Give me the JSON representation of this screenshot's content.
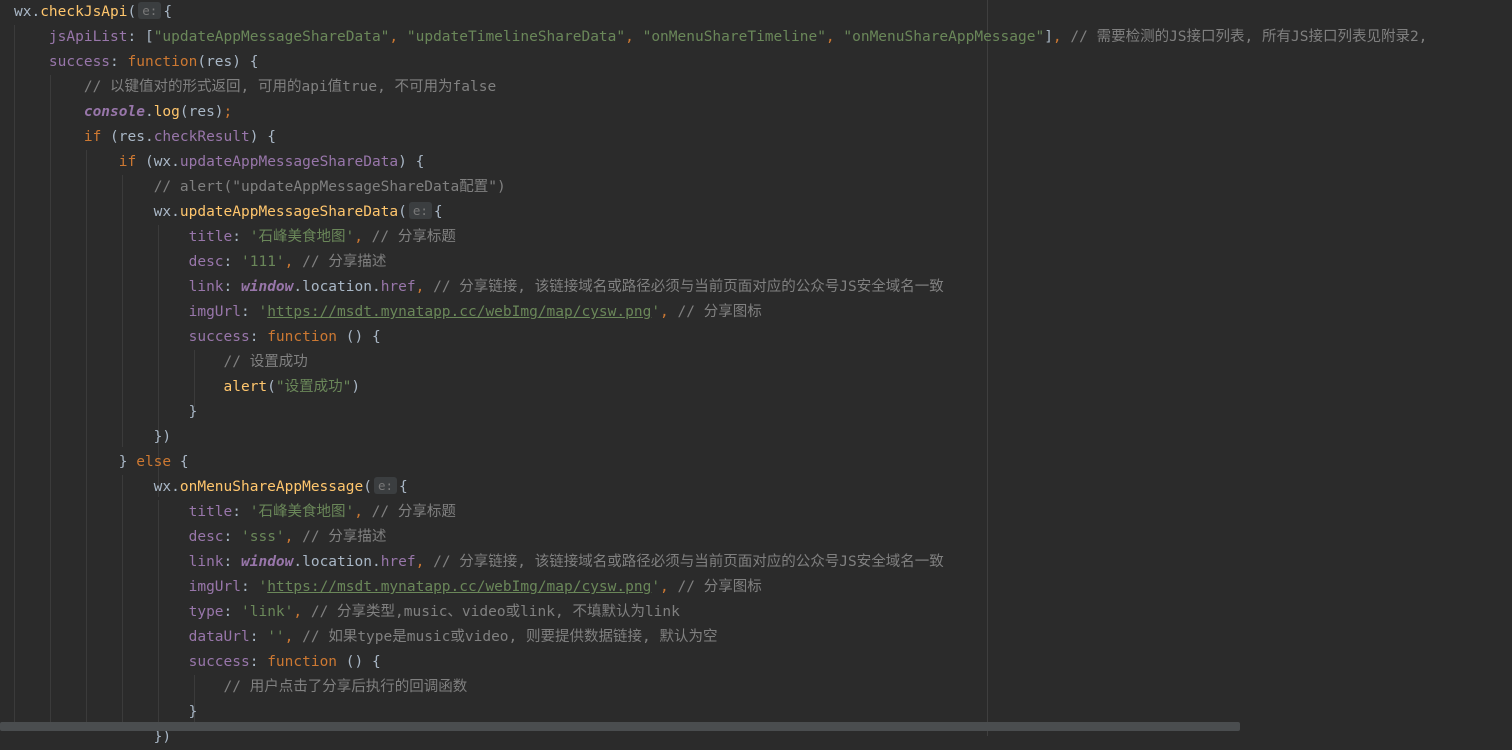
{
  "editor": {
    "param_hint": "e:",
    "lines": [
      [
        [
          "t-plain",
          "wx."
        ],
        [
          "t-fn",
          "checkJsApi"
        ],
        [
          "t-plain",
          "("
        ],
        [
          "hint",
          "e:"
        ],
        [
          "t-plain",
          "{"
        ]
      ],
      [
        [
          "t-plain",
          "    "
        ],
        [
          "t-prop",
          "jsApiList"
        ],
        [
          "t-plain",
          ": ["
        ],
        [
          "t-str",
          "\"updateAppMessageShareData\""
        ],
        [
          "t-kw",
          ", "
        ],
        [
          "t-str",
          "\"updateTimelineShareData\""
        ],
        [
          "t-kw",
          ", "
        ],
        [
          "t-str",
          "\"onMenuShareTimeline\""
        ],
        [
          "t-kw",
          ", "
        ],
        [
          "t-str",
          "\"onMenuShareAppMessage\""
        ],
        [
          "t-plain",
          "]"
        ],
        [
          "t-kw",
          ", "
        ],
        [
          "t-com",
          "// 需要检测的JS接口列表, 所有JS接口列表见附录2,"
        ]
      ],
      [
        [
          "t-plain",
          "    "
        ],
        [
          "t-prop",
          "success"
        ],
        [
          "t-plain",
          ": "
        ],
        [
          "t-kw",
          "function"
        ],
        [
          "t-plain",
          "(res) {"
        ]
      ],
      [
        [
          "t-plain",
          "        "
        ],
        [
          "t-com",
          "// 以键值对的形式返回, 可用的api值true, 不可用为false"
        ]
      ],
      [
        [
          "t-plain",
          "        "
        ],
        [
          "t-ital",
          "console"
        ],
        [
          "t-plain",
          "."
        ],
        [
          "t-fn",
          "log"
        ],
        [
          "t-plain",
          "(res)"
        ],
        [
          "t-kw",
          ";"
        ]
      ],
      [
        [
          "t-plain",
          "        "
        ],
        [
          "t-kw",
          "if "
        ],
        [
          "t-plain",
          "(res."
        ],
        [
          "t-prop",
          "checkResult"
        ],
        [
          "t-plain",
          ") {"
        ]
      ],
      [
        [
          "t-plain",
          "            "
        ],
        [
          "t-kw",
          "if "
        ],
        [
          "t-plain",
          "(wx."
        ],
        [
          "t-prop",
          "updateAppMessageShareData"
        ],
        [
          "t-plain",
          ") {"
        ]
      ],
      [
        [
          "t-plain",
          "                "
        ],
        [
          "t-com",
          "// alert(\"updateAppMessageShareData配置\")"
        ]
      ],
      [
        [
          "t-plain",
          "                wx."
        ],
        [
          "t-fn",
          "updateAppMessageShareData"
        ],
        [
          "t-plain",
          "("
        ],
        [
          "hint",
          "e:"
        ],
        [
          "t-plain",
          "{"
        ]
      ],
      [
        [
          "t-plain",
          "                    "
        ],
        [
          "t-prop",
          "title"
        ],
        [
          "t-plain",
          ": "
        ],
        [
          "t-str",
          "'石峰美食地图'"
        ],
        [
          "t-kw",
          ", "
        ],
        [
          "t-com",
          "// 分享标题"
        ]
      ],
      [
        [
          "t-plain",
          "                    "
        ],
        [
          "t-prop",
          "desc"
        ],
        [
          "t-plain",
          ": "
        ],
        [
          "t-str",
          "'111'"
        ],
        [
          "t-kw",
          ", "
        ],
        [
          "t-com",
          "// 分享描述"
        ]
      ],
      [
        [
          "t-plain",
          "                    "
        ],
        [
          "t-prop",
          "link"
        ],
        [
          "t-plain",
          ": "
        ],
        [
          "t-ital",
          "window"
        ],
        [
          "t-plain",
          ".location."
        ],
        [
          "t-prop",
          "href"
        ],
        [
          "t-kw",
          ", "
        ],
        [
          "t-com",
          "// 分享链接, 该链接域名或路径必须与当前页面对应的公众号JS安全域名一致"
        ]
      ],
      [
        [
          "t-plain",
          "                    "
        ],
        [
          "t-prop",
          "imgUrl"
        ],
        [
          "t-plain",
          ": "
        ],
        [
          "t-str",
          "'"
        ],
        [
          "t-link",
          "https://msdt.mynatapp.cc/webImg/map/cysw.png"
        ],
        [
          "t-str",
          "'"
        ],
        [
          "t-kw",
          ", "
        ],
        [
          "t-com",
          "// 分享图标"
        ]
      ],
      [
        [
          "t-plain",
          "                    "
        ],
        [
          "t-prop",
          "success"
        ],
        [
          "t-plain",
          ": "
        ],
        [
          "t-kw",
          "function "
        ],
        [
          "t-plain",
          "() {"
        ]
      ],
      [
        [
          "t-plain",
          "                        "
        ],
        [
          "t-com",
          "// 设置成功"
        ]
      ],
      [
        [
          "t-plain",
          "                        "
        ],
        [
          "t-fn",
          "alert"
        ],
        [
          "t-plain",
          "("
        ],
        [
          "t-str",
          "\"设置成功\""
        ],
        [
          "t-plain",
          ")"
        ]
      ],
      [
        [
          "t-plain",
          "                    }"
        ]
      ],
      [
        [
          "t-plain",
          "                })"
        ]
      ],
      [
        [
          "t-plain",
          "            } "
        ],
        [
          "t-kw",
          "else "
        ],
        [
          "t-plain",
          "{"
        ]
      ],
      [
        [
          "t-plain",
          "                wx."
        ],
        [
          "t-fn",
          "onMenuShareAppMessage"
        ],
        [
          "t-plain",
          "("
        ],
        [
          "hint",
          "e:"
        ],
        [
          "t-plain",
          "{"
        ]
      ],
      [
        [
          "t-plain",
          "                    "
        ],
        [
          "t-prop",
          "title"
        ],
        [
          "t-plain",
          ": "
        ],
        [
          "t-str",
          "'石峰美食地图'"
        ],
        [
          "t-kw",
          ", "
        ],
        [
          "t-com",
          "// 分享标题"
        ]
      ],
      [
        [
          "t-plain",
          "                    "
        ],
        [
          "t-prop",
          "desc"
        ],
        [
          "t-plain",
          ": "
        ],
        [
          "t-str",
          "'sss'"
        ],
        [
          "t-kw",
          ", "
        ],
        [
          "t-com",
          "// 分享描述"
        ]
      ],
      [
        [
          "t-plain",
          "                    "
        ],
        [
          "t-prop",
          "link"
        ],
        [
          "t-plain",
          ": "
        ],
        [
          "t-ital",
          "window"
        ],
        [
          "t-plain",
          ".location."
        ],
        [
          "t-prop",
          "href"
        ],
        [
          "t-kw",
          ", "
        ],
        [
          "t-com",
          "// 分享链接, 该链接域名或路径必须与当前页面对应的公众号JS安全域名一致"
        ]
      ],
      [
        [
          "t-plain",
          "                    "
        ],
        [
          "t-prop",
          "imgUrl"
        ],
        [
          "t-plain",
          ": "
        ],
        [
          "t-str",
          "'"
        ],
        [
          "t-link",
          "https://msdt.mynatapp.cc/webImg/map/cysw.png"
        ],
        [
          "t-str",
          "'"
        ],
        [
          "t-kw",
          ", "
        ],
        [
          "t-com",
          "// 分享图标"
        ]
      ],
      [
        [
          "t-plain",
          "                    "
        ],
        [
          "t-prop",
          "type"
        ],
        [
          "t-plain",
          ": "
        ],
        [
          "t-str",
          "'link'"
        ],
        [
          "t-kw",
          ", "
        ],
        [
          "t-com",
          "// 分享类型,music、video或link, 不填默认为link"
        ]
      ],
      [
        [
          "t-plain",
          "                    "
        ],
        [
          "t-prop",
          "dataUrl"
        ],
        [
          "t-plain",
          ": "
        ],
        [
          "t-str",
          "''"
        ],
        [
          "t-kw",
          ", "
        ],
        [
          "t-com",
          "// 如果type是music或video, 则要提供数据链接, 默认为空"
        ]
      ],
      [
        [
          "t-plain",
          "                    "
        ],
        [
          "t-prop",
          "success"
        ],
        [
          "t-plain",
          ": "
        ],
        [
          "t-kw",
          "function "
        ],
        [
          "t-plain",
          "() {"
        ]
      ],
      [
        [
          "t-plain",
          "                        "
        ],
        [
          "t-com",
          "// 用户点击了分享后执行的回调函数"
        ]
      ],
      [
        [
          "t-plain",
          "                    }"
        ]
      ],
      [
        [
          "t-plain",
          "                })"
        ]
      ]
    ]
  },
  "colors": {
    "background": "#2b2b2b",
    "plain": "#a9b7c6",
    "keyword": "#cc7832",
    "string": "#6a8759",
    "comment": "#808080",
    "function": "#ffc66d",
    "property": "#9876aa"
  }
}
